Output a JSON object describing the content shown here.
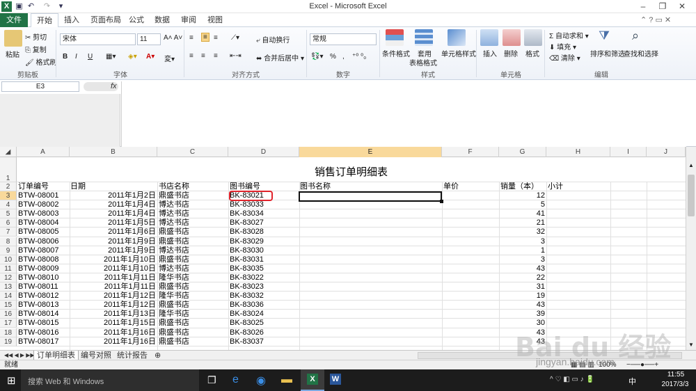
{
  "window": {
    "title": "Excel - Microsoft Excel"
  },
  "qat": {
    "undo": "↶",
    "redo": "↷"
  },
  "tabs": [
    "开始",
    "插入",
    "页面布局",
    "公式",
    "数据",
    "审阅",
    "视图"
  ],
  "file_tab": "文件",
  "ribbon": {
    "clipboard": {
      "paste": "粘贴",
      "cut": "剪切",
      "copy": "复制",
      "painter": "格式刷",
      "label": "剪贴板"
    },
    "font": {
      "name": "宋体",
      "size": "11",
      "bold": "B",
      "italic": "I",
      "underline": "U",
      "label": "字体"
    },
    "align": {
      "wrap": "自动换行",
      "merge": "合并后居中",
      "label": "对齐方式"
    },
    "number": {
      "format": "常规",
      "percent": "%",
      "comma": ",",
      "label": "数字"
    },
    "styles": {
      "cond": "条件格式",
      "table1": "套用",
      "table2": "表格格式",
      "cell": "单元格样式",
      "label": "样式"
    },
    "cells": {
      "insert": "插入",
      "delete": "删除",
      "format": "格式",
      "label": "单元格"
    },
    "editing": {
      "autosum": "自动求和",
      "fill": "填充",
      "clear": "清除",
      "sort": "排序和筛选",
      "find": "查找和选择",
      "label": "编辑"
    }
  },
  "formula": {
    "namebox": "E3",
    "fx": "fx"
  },
  "columns": [
    "A",
    "B",
    "C",
    "D",
    "E",
    "F",
    "G",
    "H",
    "I",
    "J"
  ],
  "sheet_title": "销售订单明细表",
  "headers": [
    "订单编号",
    "日期",
    "书店名称",
    "图书编号",
    "图书名称",
    "单价",
    "销量（本）",
    "小计"
  ],
  "rows": [
    [
      "BTW-08001",
      "2011年1月2日",
      "鼎盛书店",
      "BK-83021",
      "12"
    ],
    [
      "BTW-08002",
      "2011年1月4日",
      "博达书店",
      "BK-83033",
      "5"
    ],
    [
      "BTW-08003",
      "2011年1月4日",
      "博达书店",
      "BK-83034",
      "41"
    ],
    [
      "BTW-08004",
      "2011年1月5日",
      "博达书店",
      "BK-83027",
      "21"
    ],
    [
      "BTW-08005",
      "2011年1月6日",
      "鼎盛书店",
      "BK-83028",
      "32"
    ],
    [
      "BTW-08006",
      "2011年1月9日",
      "鼎盛书店",
      "BK-83029",
      "3"
    ],
    [
      "BTW-08007",
      "2011年1月9日",
      "博达书店",
      "BK-83030",
      "1"
    ],
    [
      "BTW-08008",
      "2011年1月10日",
      "鼎盛书店",
      "BK-83031",
      "3"
    ],
    [
      "BTW-08009",
      "2011年1月10日",
      "博达书店",
      "BK-83035",
      "43"
    ],
    [
      "BTW-08010",
      "2011年1月11日",
      "隆华书店",
      "BK-83022",
      "22"
    ],
    [
      "BTW-08011",
      "2011年1月11日",
      "鼎盛书店",
      "BK-83023",
      "31"
    ],
    [
      "BTW-08012",
      "2011年1月12日",
      "隆华书店",
      "BK-83032",
      "19"
    ],
    [
      "BTW-08013",
      "2011年1月12日",
      "鼎盛书店",
      "BK-83036",
      "43"
    ],
    [
      "BTW-08014",
      "2011年1月13日",
      "隆华书店",
      "BK-83024",
      "39"
    ],
    [
      "BTW-08015",
      "2011年1月15日",
      "鼎盛书店",
      "BK-83025",
      "30"
    ],
    [
      "BTW-08016",
      "2011年1月16日",
      "鼎盛书店",
      "BK-83026",
      "43"
    ],
    [
      "BTW-08017",
      "2011年1月16日",
      "鼎盛书店",
      "BK-83037",
      "43"
    ]
  ],
  "sheets": [
    "订单明细表",
    "编号对照",
    "统计报告"
  ],
  "status": {
    "ready": "就绪",
    "zoom": "100%"
  },
  "taskbar": {
    "search": "搜索 Web 和 Windows",
    "time": "11:55",
    "date": "2017/3/3",
    "ime": "中"
  },
  "watermark": "jingyan.baidu.com"
}
